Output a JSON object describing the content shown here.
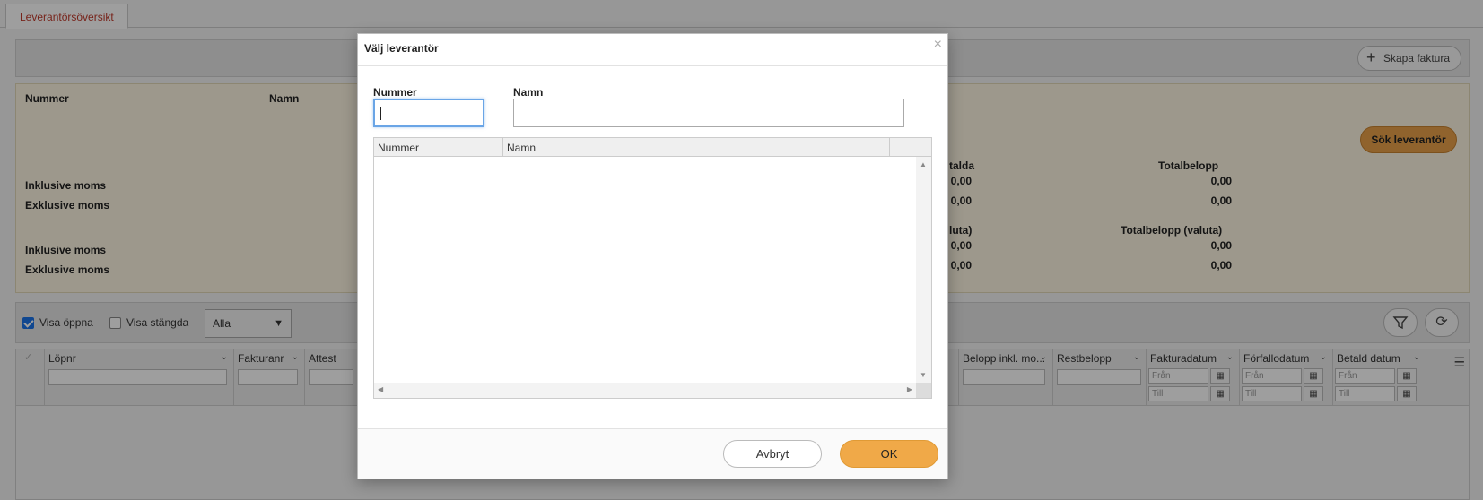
{
  "tabs": [
    {
      "label": "Leverantörsöversikt"
    }
  ],
  "toolbar": {
    "create_invoice_label": "Skapa faktura"
  },
  "summary": {
    "nummer_label": "Nummer",
    "namn_label": "Namn",
    "search_supplier_label": "Sök leverantör",
    "col_paid_label": "talda",
    "col_total_label": "Totalbelopp",
    "col_paid_currency_label": "luta)",
    "col_total_currency_label": "Totalbelopp (valuta)",
    "rows": [
      {
        "label": "Inklusive moms",
        "paid": "0,00",
        "total": "0,00"
      },
      {
        "label": "Exklusive moms",
        "paid": "0,00",
        "total": "0,00"
      },
      {
        "label": "Inklusive moms",
        "paid": "0,00",
        "total": "0,00"
      },
      {
        "label": "Exklusive moms",
        "paid": "0,00",
        "total": "0,00"
      }
    ]
  },
  "filters": {
    "show_open_label": "Visa öppna",
    "show_open_checked": true,
    "show_closed_label": "Visa stängda",
    "show_closed_checked": false,
    "select_value": "Alla"
  },
  "grid": {
    "columns": [
      "Löpnr",
      "Fakturanr",
      "Attest",
      "Belopp inkl. mo...",
      "Restbelopp",
      "Fakturadatum",
      "Förfallodatum",
      "Betald datum"
    ],
    "date_from_placeholder": "Från",
    "date_to_placeholder": "Till"
  },
  "dialog": {
    "title": "Välj leverantör",
    "close_symbol": "×",
    "nummer_label": "Nummer",
    "namn_label": "Namn",
    "nummer_value": "",
    "namn_value": "",
    "table_headers": [
      "Nummer",
      "Namn"
    ],
    "cancel_label": "Avbryt",
    "ok_label": "OK"
  },
  "colors": {
    "accent_orange": "#f0a948",
    "tab_red": "#c0392b",
    "focus_blue": "#6aa5e6"
  }
}
